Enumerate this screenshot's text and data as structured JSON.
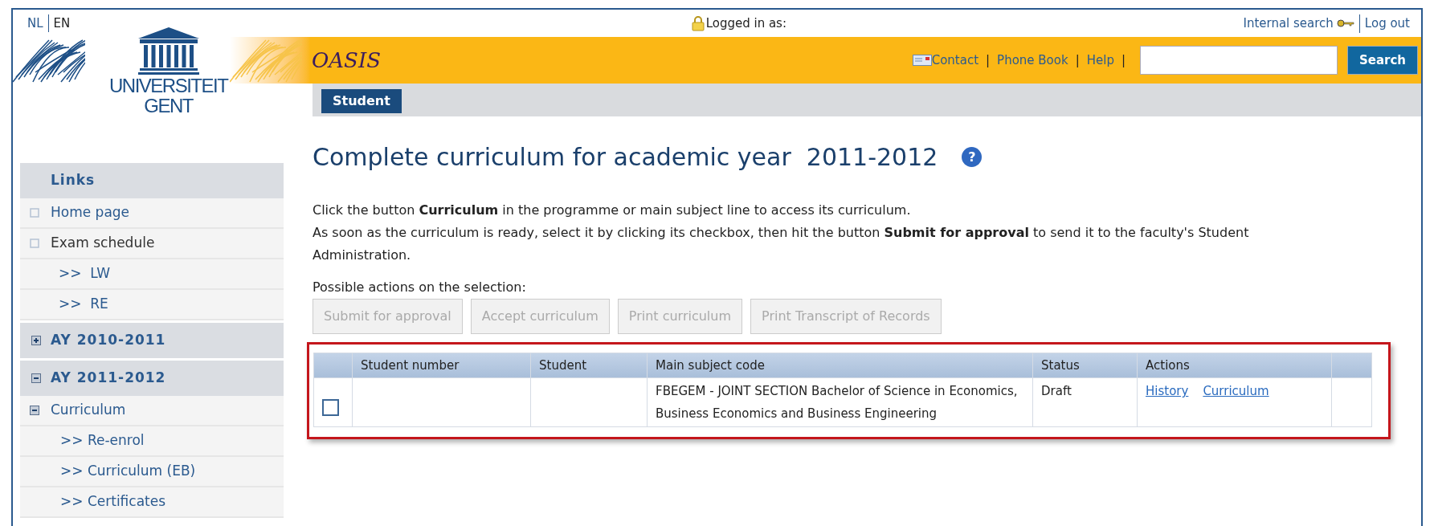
{
  "languages": [
    {
      "label": "NL",
      "selected": false
    },
    {
      "label": "EN",
      "selected": true
    }
  ],
  "logo": {
    "lines": [
      "UNIVERSITEIT",
      "GENT"
    ]
  },
  "app_name": "OASIS",
  "top_links": {
    "logged_in": "Logged in as:",
    "internal_search": "Internal search",
    "logout": "Log out"
  },
  "header_links": [
    "Contact",
    "Phone Book",
    "Help"
  ],
  "header_separator": "|",
  "help_icon": "?",
  "search": {
    "button": "Search"
  },
  "tabs": [
    {
      "label": "Student",
      "selected": true
    }
  ],
  "sidebar": {
    "sections": [
      {
        "title": "Links",
        "kind": "plain",
        "items": [
          {
            "label": "Home page",
            "link": true
          },
          {
            "label": "Exam schedule",
            "link": false,
            "children": [
              {
                "label": ">>  LW"
              },
              {
                "label": ">>  RE"
              }
            ]
          }
        ]
      },
      {
        "title": "AY 2010-2011",
        "kind": "toggle",
        "expanded": false
      },
      {
        "title": "AY 2011-2012",
        "kind": "toggle",
        "expanded": true,
        "items": [
          {
            "label": "Curriculum",
            "expanded": true,
            "link": true,
            "children": [
              {
                "label": ">> Re-enrol"
              },
              {
                "label": ">> Curriculum (EB)"
              },
              {
                "label": ">> Certificates"
              }
            ]
          }
        ]
      }
    ]
  },
  "page": {
    "title": "Complete curriculum for academic year  2011-2012",
    "instructions": [
      "Click the button **Curriculum** in the programme or main subject line to access its curriculum.",
      "As soon as the curriculum is ready, select it by clicking its checkbox, then hit the button **Submit for approval** to send it to the faculty's Student Administration."
    ],
    "actions_label": "Possible actions on the selection:",
    "actions": [
      {
        "label": "Submit for approval",
        "disabled": true
      },
      {
        "label": "Accept curriculum",
        "disabled": true
      },
      {
        "label": "Print curriculum",
        "disabled": true
      },
      {
        "label": "Print Transcript of Records",
        "disabled": true
      }
    ]
  },
  "table": {
    "columns": [
      "Student number",
      "Student",
      "Main subject code",
      "Status",
      "Actions"
    ],
    "rows": [
      {
        "checked": false,
        "main_subject_code": "FBEGEM - JOINT SECTION Bachelor of Science in Economics, Business Economics and Business Engineering",
        "status": "Draft",
        "actions": [
          "History",
          "Curriculum"
        ]
      }
    ]
  }
}
